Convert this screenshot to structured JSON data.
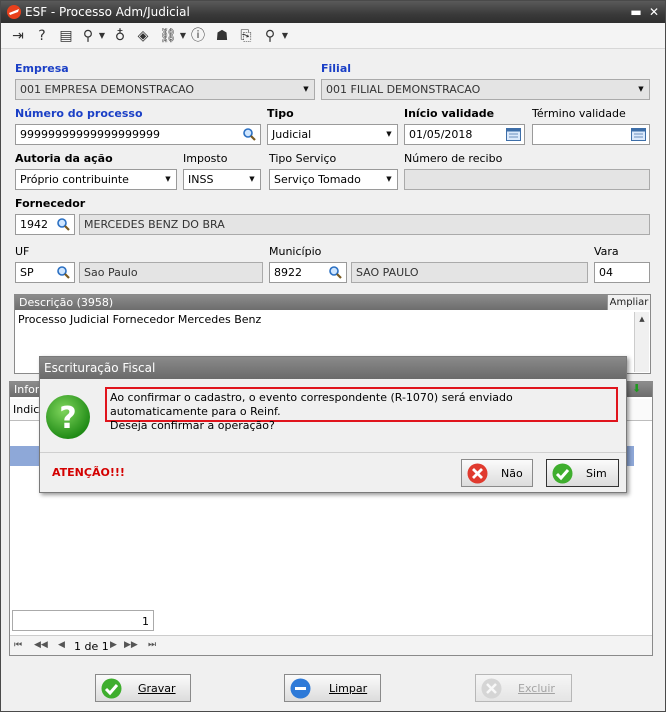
{
  "window": {
    "title": "ESF - Processo Adm/Judicial"
  },
  "form": {
    "empresa_label": "Empresa",
    "empresa_value": "001 EMPRESA DEMONSTRACAO",
    "filial_label": "Filial",
    "filial_value": "001 FILIAL DEMONSTRACAO",
    "numero_label": "Número do processo",
    "numero_value": "99999999999999999999",
    "tipo_label": "Tipo",
    "tipo_value": "Judicial",
    "inicio_label": "Início validade",
    "inicio_value": "01/05/2018",
    "termino_label": "Término validade",
    "termino_value": "",
    "autoria_label": "Autoria da ação",
    "autoria_value": "Próprio contribuinte",
    "imposto_label": "Imposto",
    "imposto_value": "INSS",
    "tipo_servico_label": "Tipo Serviço",
    "tipo_servico_value": "Serviço Tomado",
    "recibo_label": "Número de recibo",
    "recibo_value": "",
    "fornecedor_label": "Fornecedor",
    "fornecedor_code": "1942",
    "fornecedor_name": "MERCEDES BENZ DO BRA",
    "uf_label": "UF",
    "uf_code": "SP",
    "uf_name": "Sao Paulo",
    "municipio_label": "Município",
    "municipio_code": "8922",
    "municipio_name": "SAO PAULO",
    "vara_label": "Vara",
    "vara_value": "04"
  },
  "descricao": {
    "header": "Descrição (3958)",
    "ampliar": "Ampliar",
    "text": "Processo Judicial Fornecedor Mercedes Benz"
  },
  "info_panel": {
    "header": "Inforr",
    "column": "Indica",
    "count": "1",
    "page": "1 de 1"
  },
  "dialog": {
    "title": "Escrituração Fiscal",
    "message_line1": "Ao confirmar o cadastro, o evento correspondente (R-1070) será enviado automaticamente para o Reinf.",
    "message_line2": "Deseja confirmar a operação?",
    "warning": "ATENÇÃO!!!",
    "no_label": "Não",
    "yes_label": "Sim"
  },
  "buttons": {
    "gravar": "Gravar",
    "limpar": "Limpar",
    "excluir": "Excluir"
  },
  "colors": {
    "accent_blue": "#1a3fc6",
    "dialog_border_red": "#e0141c",
    "warning_red": "#d40000"
  }
}
